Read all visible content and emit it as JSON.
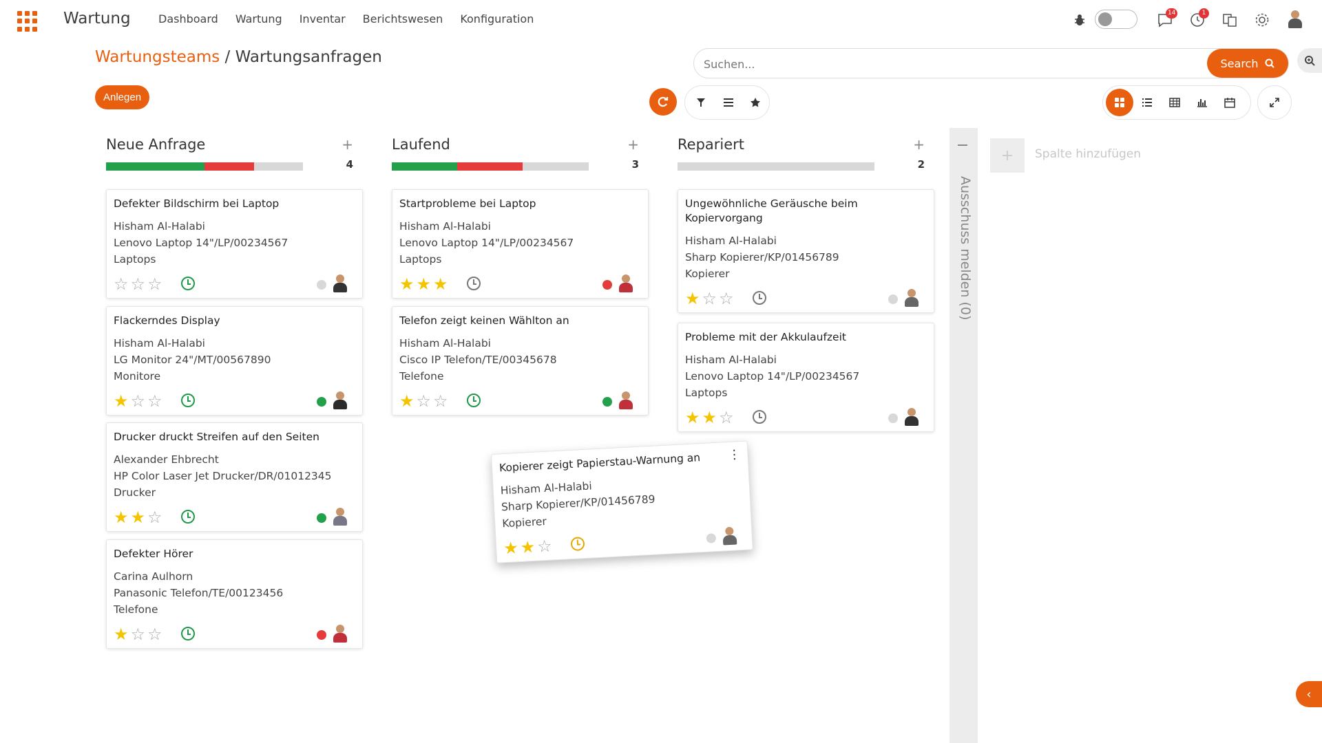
{
  "app": {
    "title": "Wartung",
    "menu": [
      "Dashboard",
      "Wartung",
      "Inventar",
      "Berichtswesen",
      "Konfiguration"
    ],
    "badges": {
      "messages": "14",
      "activities": "1"
    }
  },
  "breadcrumb": {
    "parent": "Wartungsteams",
    "separator": "/",
    "current": "Wartungsanfragen"
  },
  "create_label": "Anlegen",
  "search": {
    "placeholder": "Suchen...",
    "button": "Search"
  },
  "side_panel": {
    "label": "Ausschuss melden (0)"
  },
  "add_column_label": "Spalte hinzufügen",
  "columns": [
    {
      "name": "Neue Anfrage",
      "count": "4",
      "progress": {
        "green": 0.5,
        "red": 0.25
      }
    },
    {
      "name": "Laufend",
      "count": "3",
      "progress": {
        "green": 0.33,
        "red": 0.33
      }
    },
    {
      "name": "Repariert",
      "count": "2",
      "progress": {
        "green": 0,
        "red": 0
      }
    }
  ],
  "cards": {
    "c1": {
      "title": "Defekter Bildschirm bei Laptop",
      "person": "Hisham Al-Halabi",
      "equipment": "Lenovo Laptop 14\"/LP/00234567",
      "category": "Laptops",
      "stars": 0,
      "status": "grey"
    },
    "c2": {
      "title": "Flackerndes Display",
      "person": "Hisham Al-Halabi",
      "equipment": "LG Monitor 24\"/MT/00567890",
      "category": "Monitore",
      "stars": 1,
      "status": "green"
    },
    "c3": {
      "title": "Drucker druckt Streifen auf den Seiten",
      "person": "Alexander Ehbrecht",
      "equipment": "HP Color Laser Jet Drucker/DR/01012345",
      "category": "Drucker",
      "stars": 2,
      "status": "green"
    },
    "c4": {
      "title": "Defekter Hörer",
      "person": "Carina Aulhorn",
      "equipment": "Panasonic Telefon/TE/00123456",
      "category": "Telefone",
      "stars": 1,
      "status": "red"
    },
    "c5": {
      "title": "Startprobleme bei Laptop",
      "person": "Hisham Al-Halabi",
      "equipment": "Lenovo Laptop 14\"/LP/00234567",
      "category": "Laptops",
      "stars": 3,
      "status": "red"
    },
    "c6": {
      "title": "Telefon zeigt keinen Wählton an",
      "person": "Hisham Al-Halabi",
      "equipment": "Cisco IP Telefon/TE/00345678",
      "category": "Telefone",
      "stars": 1,
      "status": "green"
    },
    "c7": {
      "title": "Ungewöhnliche Geräusche beim Kopiervorgang",
      "person": "Hisham Al-Halabi",
      "equipment": "Sharp Kopierer/KP/01456789",
      "category": "Kopierer",
      "stars": 1,
      "status": "grey"
    },
    "c8": {
      "title": "Probleme mit der Akkulaufzeit",
      "person": "Hisham Al-Halabi",
      "equipment": "Lenovo Laptop 14\"/LP/00234567",
      "category": "Laptops",
      "stars": 2,
      "status": "grey"
    },
    "c9": {
      "title": "Kopierer zeigt Papierstau-Warnung an",
      "person": "Hisham Al-Halabi",
      "equipment": "Sharp Kopierer/KP/01456789",
      "category": "Kopierer",
      "stars": 2,
      "status": "grey"
    }
  },
  "colors": {
    "accent": "#e8600f",
    "green": "#22a04b",
    "red": "#e53b3b"
  }
}
